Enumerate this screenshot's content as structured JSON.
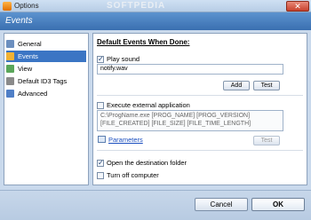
{
  "window": {
    "title": "Options",
    "watermark": "SOFTPEDIA",
    "close_label": "✕"
  },
  "header": {
    "title": "Events"
  },
  "sidebar": {
    "items": [
      {
        "label": "General",
        "icon": "general-icon",
        "active": false
      },
      {
        "label": "Events",
        "icon": "events-icon",
        "active": true
      },
      {
        "label": "View",
        "icon": "view-icon",
        "active": false
      },
      {
        "label": "Default ID3 Tags",
        "icon": "tag-icon",
        "active": false
      },
      {
        "label": "Advanced",
        "icon": "advanced-icon",
        "active": false
      }
    ]
  },
  "main": {
    "section_title": "Default Events When Done:",
    "play_sound": {
      "label": "Play sound",
      "checked": true,
      "value": "notify.wav",
      "add_label": "Add",
      "test_label": "Test"
    },
    "execute": {
      "label": "Execute external application",
      "checked": false,
      "command": "C:\\ProgName.exe [PROG_NAME] [PROG_VERSION] [FILE_CREATED] [FILE_SIZE] [FILE_TIME_LENGTH]",
      "parameters_label": "Parameters",
      "test_label": "Test"
    },
    "open_folder": {
      "label": "Open the destination folder",
      "checked": true
    },
    "turn_off": {
      "label": "Turn off computer",
      "checked": false
    }
  },
  "footer": {
    "cancel_label": "Cancel",
    "ok_label": "OK"
  }
}
